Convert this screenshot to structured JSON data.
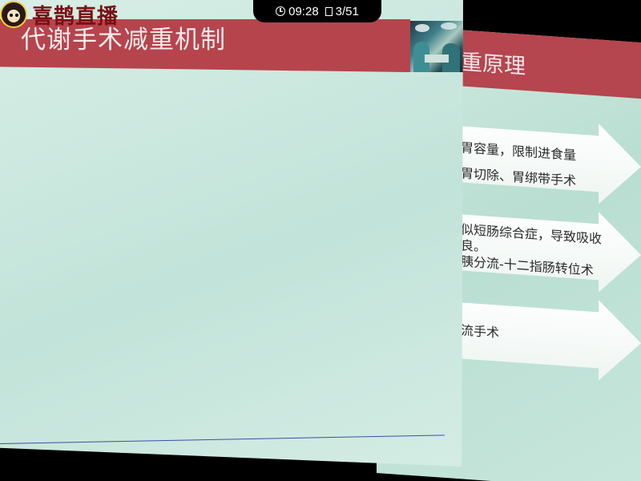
{
  "status_bar": {
    "time": "09:28",
    "page_indicator": "3/51"
  },
  "watermark": {
    "logo_text": "喜鹊直播"
  },
  "front_slide": {
    "title": "代谢手术减重机制"
  },
  "back_slide": {
    "title": "重原理",
    "arrows": [
      {
        "lines": [
          "胃容量，限制进食量",
          "胃切除、胃绑带手术"
        ]
      },
      {
        "lines": [
          "似短肠综合症，导致吸收",
          "良。",
          "胰分流-十二指肠转位术"
        ]
      },
      {
        "lines": [
          "流手术"
        ]
      }
    ]
  },
  "colors": {
    "header_red": "#b6444d",
    "slide_bg": "#c2e3d9",
    "logo_text": "#7a0e14"
  }
}
